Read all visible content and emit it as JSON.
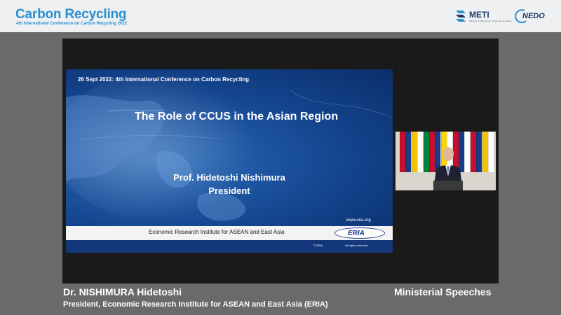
{
  "header": {
    "brand_title": "Carbon Recycling",
    "brand_subtitle": "4th International Conference on Carbon Recycling 2022",
    "meti_label": "METI",
    "meti_sub": "Ministry of Economy, Trade and Industry",
    "nedo_label": "NEDO",
    "colors": {
      "brand": "#2b8fd0",
      "partner": "#1a3a6a"
    }
  },
  "slide": {
    "date_line": "26 Sept 2022: 4th International Conference on Carbon Recycling",
    "title": "The Role of CCUS in the Asian Region",
    "speaker": "Prof. Hidetoshi Nishimura",
    "speaker_role": "President",
    "url": "www.eria.org",
    "institute": "Economic Research Institute for ASEAN and East Asia",
    "logo_text": "ERIA",
    "copyright": "© ERIA.",
    "rights": "All rights reserved.",
    "colors": {
      "background": "#14458f",
      "band": "#f3f3f3",
      "footer": "#13377a"
    }
  },
  "video": {
    "flag_colors": [
      "#c8102e",
      "#1a3a8a",
      "#f2c400",
      "#ffffff",
      "#00843d",
      "#c8102e",
      "#1a3a8a",
      "#ffd700",
      "#ffffff",
      "#c8102e",
      "#1a3a8a",
      "#ffffff",
      "#c8102e",
      "#1a3a8a",
      "#f2c400",
      "#ffffff"
    ]
  },
  "footer": {
    "speaker_name": "Dr. NISHIMURA Hidetoshi",
    "speaker_title": "President, Economic Research Institute for ASEAN and East Asia (ERIA)",
    "section": "Ministerial Speeches"
  }
}
